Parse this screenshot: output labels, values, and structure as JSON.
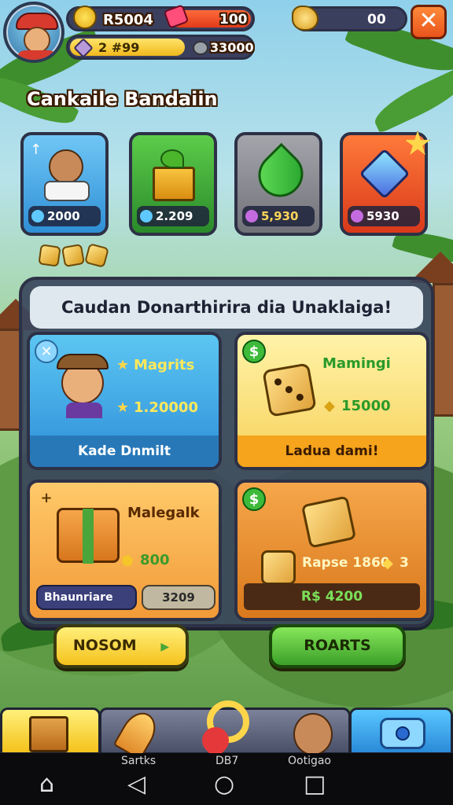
{
  "hud": {
    "level_badge": "$",
    "cash_value": "R5004",
    "ticket_value": "100",
    "currency_left_value": "2 #99",
    "currency_right_value": "33000",
    "gold_value": "00",
    "close_label": "✕"
  },
  "section_title": "Cankaile Bandaiin",
  "categories": [
    {
      "price": "2000",
      "color": "#3fa6e4"
    },
    {
      "price": "2.209",
      "color": "#3aa83d"
    },
    {
      "price": "5,930",
      "color": "#7f8087"
    },
    {
      "price": "5930",
      "color": "#e8502a"
    }
  ],
  "panel": {
    "title": "Caudan Donarthirira dia Unaklaiga!",
    "offers": [
      {
        "name": "Magrits",
        "cost": "1.20000",
        "footer": "Kade Dnmilt",
        "tag": "✕"
      },
      {
        "name": "Mamingi",
        "cost": "15000",
        "footer": "Ladua dami!",
        "tag": "$"
      },
      {
        "name": "Malegalk",
        "cost": "800",
        "tag": "+",
        "left_btn": "Bhaunriare",
        "right_btn": "3209"
      },
      {
        "name": "Rapse 1860",
        "cost_suffix": "3",
        "tag": "$",
        "footer": "R$ 4200"
      }
    ]
  },
  "buttons": {
    "left": "NOSOM",
    "left_arrow": "▶",
    "right": "ROARTS"
  },
  "bottom_nav": {
    "label_1": "Sartks",
    "label_2": "DB7",
    "label_3": "Ootigao"
  },
  "system_nav": {
    "home": "⌂",
    "back": "◁",
    "circle": "○",
    "square": "□"
  }
}
